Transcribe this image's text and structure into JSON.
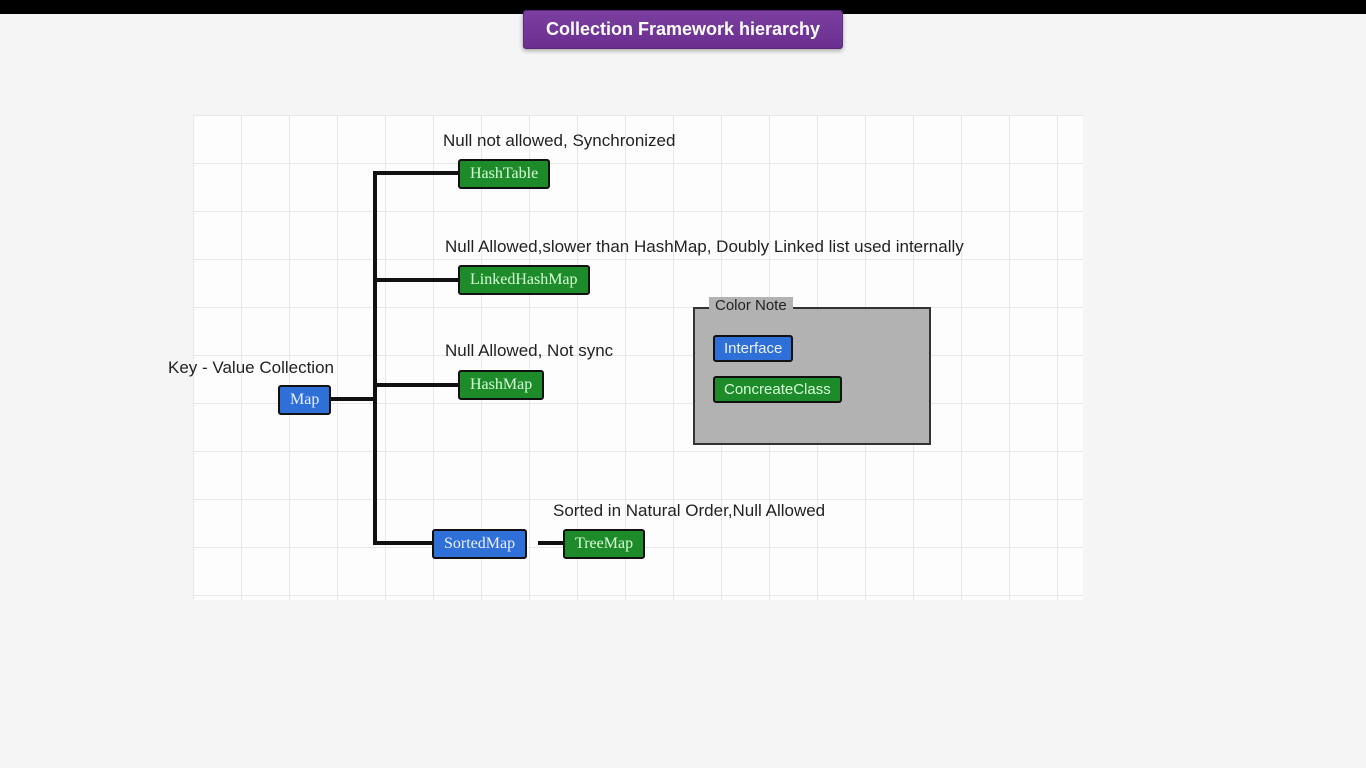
{
  "title": "Collection Framework hierarchy",
  "root_label": "Key - Value Collection",
  "root_node": "Map",
  "children": {
    "hashtable": {
      "name": "HashTable",
      "note": "Null not allowed, Synchronized"
    },
    "linkedhashmap": {
      "name": "LinkedHashMap",
      "note": "Null Allowed,slower than HashMap, Doubly Linked list used internally"
    },
    "hashmap": {
      "name": "HashMap",
      "note": "Null Allowed, Not sync"
    },
    "sortedmap": {
      "name": "SortedMap"
    },
    "treemap": {
      "name": "TreeMap",
      "note": "Sorted in Natural Order,Null Allowed"
    }
  },
  "legend": {
    "title": "Color Note",
    "interface": "Interface",
    "concrete": "ConcreateClass"
  },
  "colors": {
    "interface": "#2f6fd8",
    "concrete": "#1e8b2b",
    "banner": "#6a2f8f"
  }
}
